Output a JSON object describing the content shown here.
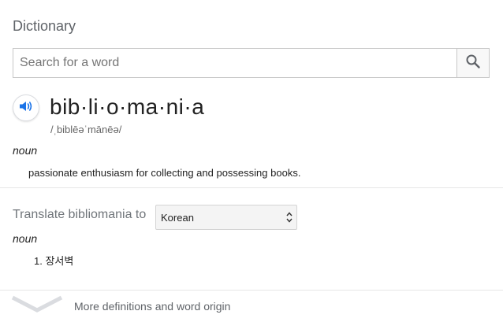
{
  "dictionary": {
    "title": "Dictionary",
    "search": {
      "placeholder": "Search for a word",
      "value": "",
      "button_icon": "magnifier-icon"
    },
    "entry": {
      "word": "bib·li·o·ma·ni·a",
      "phonetic": "/ˌbiblēəˈmānēə/",
      "audio_icon": "speaker-icon",
      "part_of_speech": "noun",
      "definition": "passionate enthusiasm for collecting and possessing books."
    },
    "translate": {
      "label": "Translate bibliomania to",
      "selected_language": "Korean",
      "part_of_speech": "noun",
      "items": [
        {
          "number": "1.",
          "text": "장서벽"
        }
      ]
    },
    "footer": {
      "more_label": "More definitions and word origin",
      "icon": "chevron-down-icon"
    },
    "colors": {
      "accent_blue": "#1a73e8",
      "muted_text": "#70757a",
      "border": "#c8c8c8"
    }
  }
}
